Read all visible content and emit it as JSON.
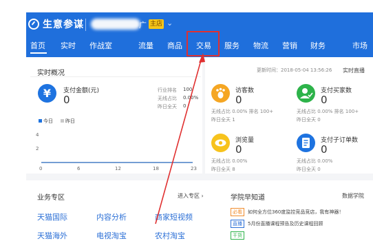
{
  "header": {
    "brand": "生意参谋",
    "shop_suffix": "广",
    "shop_badge": "主店",
    "caret": "⌄",
    "nav": [
      {
        "label": "首页",
        "active": true
      },
      {
        "label": "实时"
      },
      {
        "label": "作战室"
      },
      {
        "label": "流量"
      },
      {
        "label": "商品"
      },
      {
        "label": "交易",
        "highlighted": true
      },
      {
        "label": "服务"
      },
      {
        "label": "物流"
      },
      {
        "label": "营销"
      },
      {
        "label": "财务"
      },
      {
        "label": "市场"
      }
    ],
    "highlight_color": "#e03030"
  },
  "realtime": {
    "title": "实时概况",
    "update_time": "更新时间：2018-05-04 13:56:26",
    "more_link": "实时直播",
    "payment": {
      "label": "支付金额(元)",
      "value": "0",
      "rank_label": "行业排名",
      "rank_value": "100",
      "wireless_label": "无线占比",
      "wireless_value": "0.00%",
      "yesterday_label": "昨日全天",
      "yesterday_value": "0"
    },
    "legend": {
      "today": "今日",
      "yesterday": "昨日"
    },
    "chart_data": {
      "type": "line",
      "x_ticks": [
        "0",
        "6",
        "12",
        "18",
        "23"
      ],
      "y_ticks": [
        "4",
        "2"
      ],
      "series": [
        {
          "name": "今日",
          "values": [
            0,
            0,
            0,
            0,
            0
          ]
        },
        {
          "name": "昨日",
          "values": [
            0,
            0,
            0,
            0,
            0
          ]
        }
      ]
    },
    "metrics": [
      {
        "key": "visitors",
        "label": "访客数",
        "value": "0",
        "icon": "footprint-icon",
        "color": "#f5a623",
        "row1": "无线占比  0.00%   排名  100+",
        "row2": "昨日全天  1"
      },
      {
        "key": "buyers",
        "label": "支付买家数",
        "value": "0",
        "icon": "user-check-icon",
        "color": "#2db34a",
        "row1": "无线占比  0.00%   排名  100+",
        "row2": "昨日全天  0"
      },
      {
        "key": "pageviews",
        "label": "浏览量",
        "value": "0",
        "icon": "eye-icon",
        "color": "#f7c31d",
        "row1": "无线占比  0.00%",
        "row2": "昨日全天  8"
      },
      {
        "key": "orders",
        "label": "支付子订单数",
        "value": "0",
        "icon": "order-icon",
        "color": "#1e73e0",
        "row1": "无线占比  0.00%",
        "row2": "昨日全天  0"
      }
    ]
  },
  "business": {
    "title": "业务专区",
    "enter": "进入专区 ›",
    "links": [
      "天猫国际",
      "内容分析",
      "商家短视频",
      "天猫海外",
      "电视淘宝",
      "农村淘宝"
    ]
  },
  "academy": {
    "title": "学院早知道",
    "more": "数据学院",
    "items": [
      {
        "tag": "必看",
        "tag_color": "#f08c2c",
        "text": "如何全方位360度监控竞品竞店，我有神器！"
      },
      {
        "tag": "直播",
        "tag_color": "#2b6fd6",
        "text": "5月份直播课程预告及历史课程回顾"
      },
      {
        "tag": "干货",
        "tag_color": "#2db34a",
        "text": ""
      }
    ]
  }
}
